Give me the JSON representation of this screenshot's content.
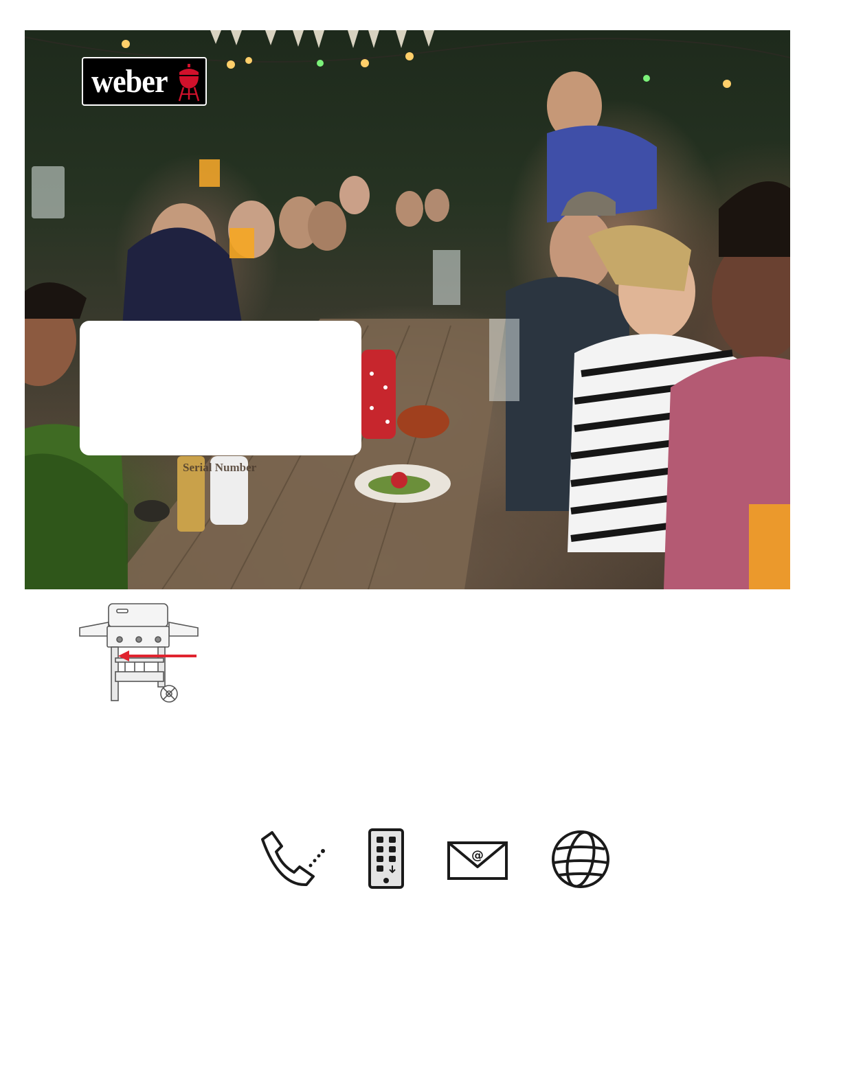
{
  "brand": {
    "logo_text": "weber",
    "logo_bg": "#000000",
    "logo_fg": "#ffffff",
    "kettle_color": "#d0112b"
  },
  "hero": {
    "scene": "outdoor-dinner-party-photo",
    "serial_label": "Serial Number"
  },
  "grill_diagram": {
    "icon": "gas-grill-icon",
    "arrow_color": "#e0242f"
  },
  "contact_icons": [
    {
      "name": "phone-icon"
    },
    {
      "name": "mobile-app-icon"
    },
    {
      "name": "email-icon"
    },
    {
      "name": "globe-icon"
    }
  ]
}
